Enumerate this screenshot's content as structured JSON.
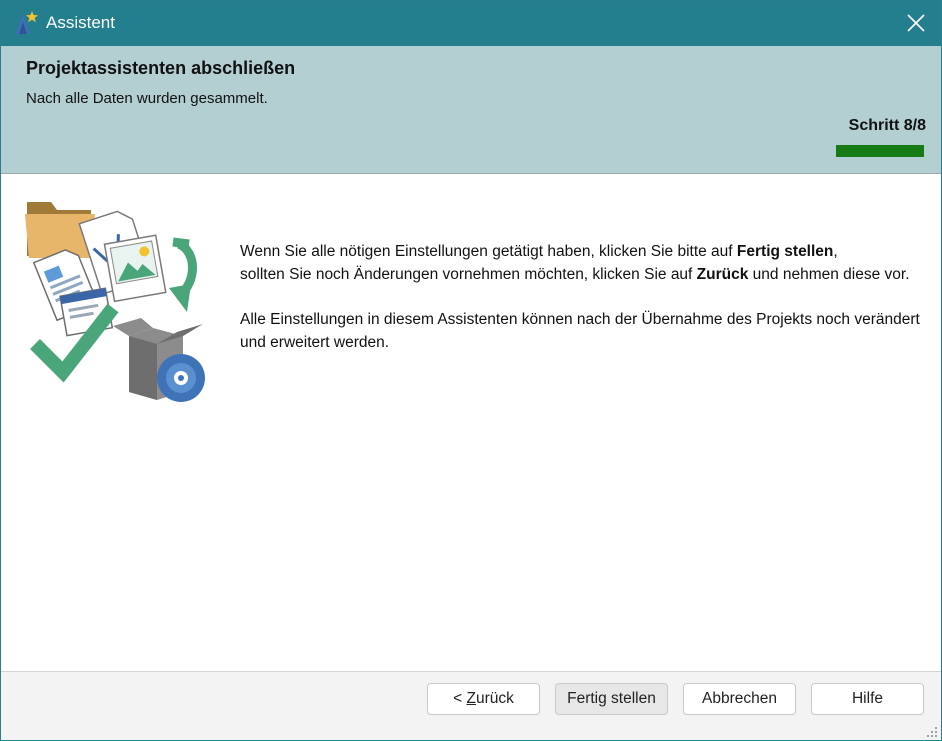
{
  "window": {
    "title": "Assistent",
    "app_icon": "wizard-hat-icon",
    "close_icon": "close-icon"
  },
  "header": {
    "title": "Projektassistenten abschließen",
    "subtitle": "Nach alle Daten wurden gesammelt.",
    "step_label": "Schritt 8/8",
    "step_current": 8,
    "step_total": 8,
    "progress_color": "#157c15"
  },
  "body": {
    "illustration": "project-files-illustration",
    "p1_a": "Wenn Sie alle nötigen Einstellungen getätigt haben, klicken Sie bitte auf ",
    "p1_b": "Fertig stellen",
    "p1_c": ",",
    "p1_d": "sollten Sie noch Änderungen vornehmen möchten, klicken Sie auf ",
    "p1_e": "Zurück",
    "p1_f": " und nehmen diese vor.",
    "p2": "Alle Einstellungen in diesem Assistenten können nach der Übernahme des Projekts noch verändert und erweitert werden."
  },
  "footer": {
    "back_prefix": "< ",
    "back_mnemonic": "Z",
    "back_rest": "urück",
    "finish": "Fertig stellen",
    "cancel": "Abbrechen",
    "help": "Hilfe"
  },
  "colors": {
    "titlebar": "#237f8d",
    "header": "#b3cfd2",
    "accent_green": "#4aa57a"
  }
}
